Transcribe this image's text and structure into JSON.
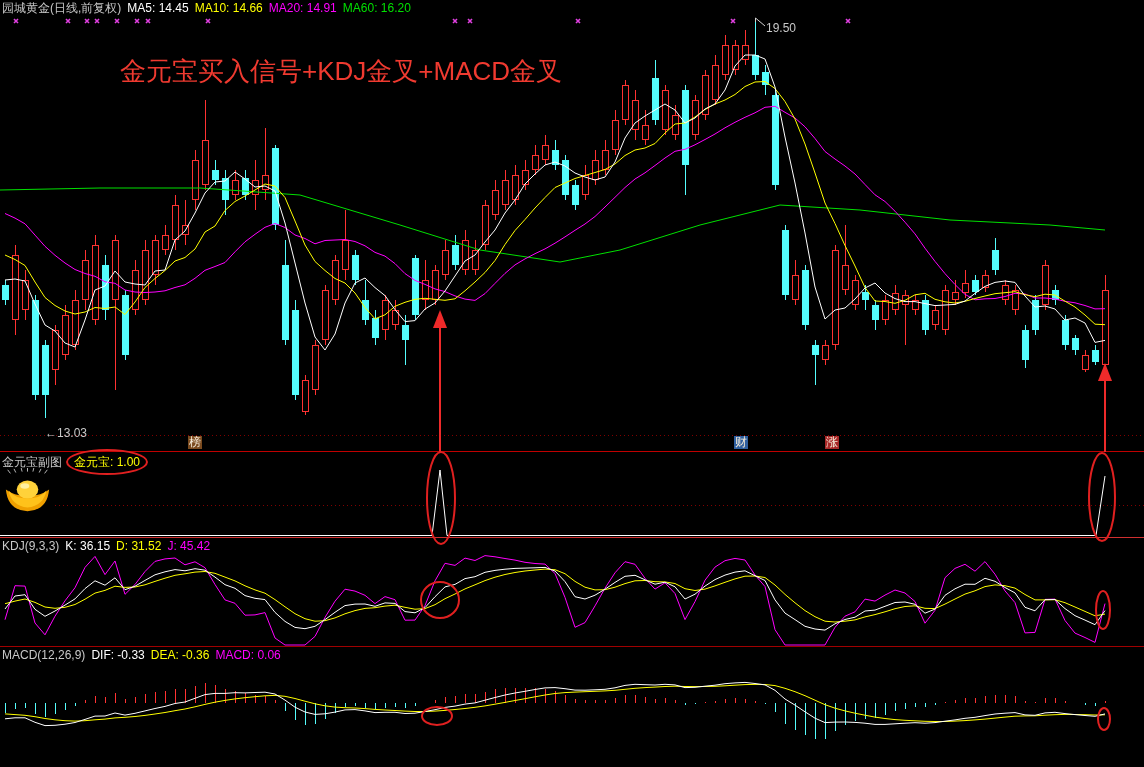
{
  "main_chart": {
    "title": "园城黄金(日线,前复权)",
    "indicators": [
      {
        "label": "MA5: 14.45",
        "color": "#ffffff"
      },
      {
        "label": "MA10: 14.66",
        "color": "#ffff00"
      },
      {
        "label": "MA20: 14.91",
        "color": "#ff00ff"
      },
      {
        "label": "MA60: 16.20",
        "color": "#00e000"
      }
    ],
    "caption": "金元宝买入信号+KDJ金叉+MACD金叉",
    "high_label": "19.50",
    "low_label": "←13.03",
    "event_markers": [
      {
        "label": "榜",
        "color": "#7a4a1e"
      },
      {
        "label": "财",
        "color": "#2f5f9f"
      },
      {
        "label": "涨",
        "color": "#a82828"
      }
    ]
  },
  "gold_panel": {
    "title": "金元宝副图",
    "readout": "金元宝: 1.00"
  },
  "kdj_panel": {
    "title": "KDJ(9,3,3)",
    "indicators": [
      {
        "label": "K: 36.15",
        "color": "#ffffff"
      },
      {
        "label": "D: 31.52",
        "color": "#ffff00"
      },
      {
        "label": "J: 45.42",
        "color": "#ff00ff"
      }
    ]
  },
  "macd_panel": {
    "title": "MACD(12,26,9)",
    "indicators": [
      {
        "label": "DIF: -0.33",
        "color": "#ffffff"
      },
      {
        "label": "DEA: -0.36",
        "color": "#ffff00"
      },
      {
        "label": "MACD: 0.06",
        "color": "#ff00ff"
      }
    ]
  }
}
